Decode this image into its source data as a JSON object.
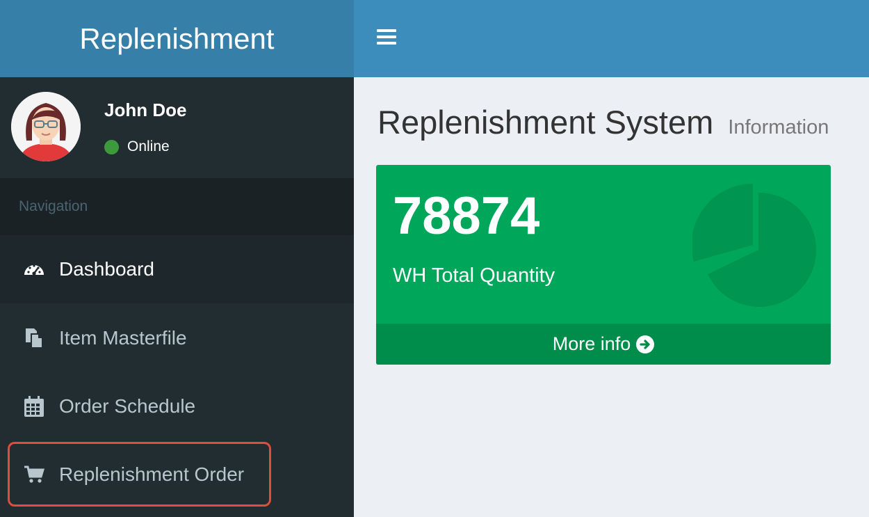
{
  "app": {
    "title": "Replenishment"
  },
  "user": {
    "name": "John Doe",
    "status": "Online"
  },
  "sidebar": {
    "header": "Navigation",
    "items": [
      {
        "label": "Dashboard",
        "icon": "dashboard-icon",
        "active": true
      },
      {
        "label": "Item Masterfile",
        "icon": "copy-icon",
        "active": false
      },
      {
        "label": "Order Schedule",
        "icon": "calendar-icon",
        "active": false
      },
      {
        "label": "Replenishment Order",
        "icon": "cart-icon",
        "active": false
      }
    ]
  },
  "content": {
    "title": "Replenishment System",
    "subtitle": "Information",
    "box": {
      "value": "78874",
      "label": "WH Total Quantity",
      "footer": "More info",
      "icon": "pie-chart-icon"
    }
  },
  "colors": {
    "logo_bg": "#367fa9",
    "topbar_bg": "#3c8dbc",
    "sidebar_bg": "#222d32",
    "box_bg": "#00a65a",
    "box_footer_bg": "#008d4c",
    "highlight": "#e24c3a",
    "online": "#3c9a3c"
  }
}
